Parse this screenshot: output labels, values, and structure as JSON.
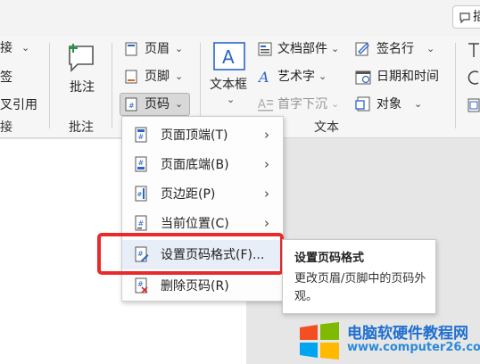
{
  "ribbon": {
    "left_partial": {
      "item1": "接",
      "item2": "签",
      "item3": "叉引用",
      "group": "接"
    },
    "comment_group": {
      "button": "批注",
      "group": "批注"
    },
    "header_footer": {
      "header": "页眉",
      "footer": "页脚",
      "page_number": "页码"
    },
    "text_group": {
      "textbox": "文本框",
      "doc_parts": "文档部件",
      "wordart": "艺术字",
      "dropcap": "首字下沉",
      "signature": "签名行",
      "datetime": "日期和时间",
      "object": "对象",
      "group": "文本"
    },
    "right_partial": {
      "top_button": "插"
    }
  },
  "page_number_menu": {
    "items": [
      {
        "label": "页面顶端(T)",
        "has_submenu": true
      },
      {
        "label": "页面底端(B)",
        "has_submenu": true
      },
      {
        "label": "页边距(P)",
        "has_submenu": true
      },
      {
        "label": "当前位置(C)",
        "has_submenu": true
      },
      {
        "label": "设置页码格式(F)...",
        "has_submenu": false,
        "highlighted": true
      },
      {
        "label": "删除页码(R)",
        "has_submenu": false
      }
    ]
  },
  "tooltip": {
    "title": "设置页码格式",
    "description": "更改页眉/页脚中的页码外观。"
  },
  "watermark": {
    "line1": "电脑软硬件教程网",
    "line2": "www.computer26.com"
  },
  "colors": {
    "accent_blue": "#2b66c4",
    "highlight_red": "#ea2a2a",
    "menu_highlight": "#e8eef8"
  }
}
